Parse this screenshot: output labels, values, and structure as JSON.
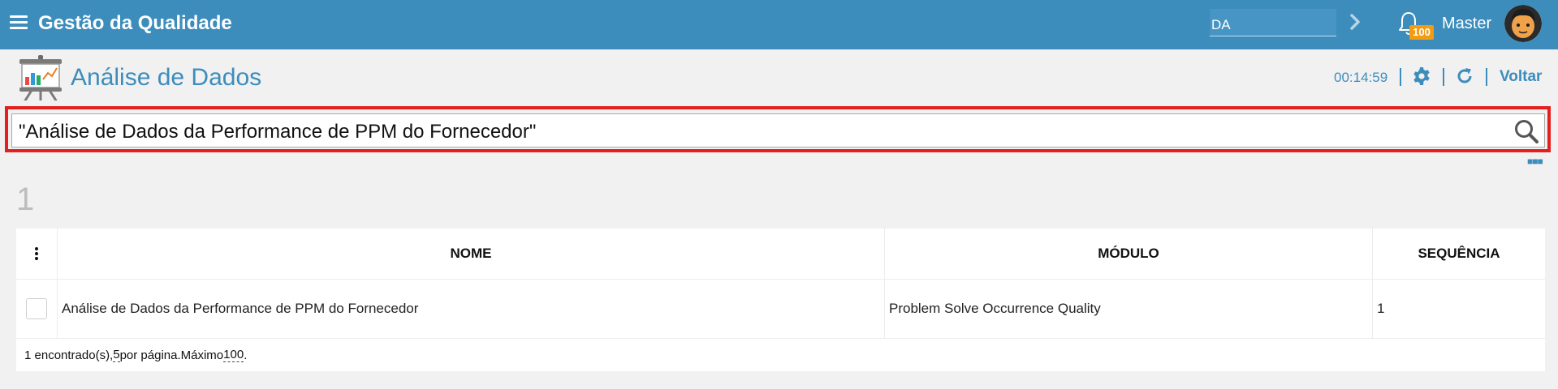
{
  "header": {
    "app_title": "Gestão da Qualidade",
    "company_value": "DA",
    "notification_count": "100",
    "user_name": "Master",
    "bar_color": "#3c8dbc",
    "badge_color": "#f39c12"
  },
  "page": {
    "title": "Análise de Dados",
    "timer": "00:14:59",
    "back_label": "Voltar",
    "icons": [
      "presentation-chart-icon",
      "gear-icon",
      "refresh-icon"
    ]
  },
  "search": {
    "value": "\"Análise de Dados da Performance de PPM do Fornecedor\"",
    "highlight_color": "#e3201f"
  },
  "results": {
    "count": "1",
    "columns": {
      "nome": "NOME",
      "modulo": "MÓDULO",
      "sequencia": "SEQUÊNCIA"
    },
    "rows": [
      {
        "nome": "Análise de Dados da Performance de PPM do Fornecedor",
        "modulo": "Problem Solve Occurrence Quality",
        "sequencia": "1"
      }
    ],
    "footer": {
      "found_text": "1 encontrado(s), ",
      "per_page_value": "5",
      "per_page_text": " por página.Máximo ",
      "max_value": "100",
      "end_text": "."
    }
  }
}
